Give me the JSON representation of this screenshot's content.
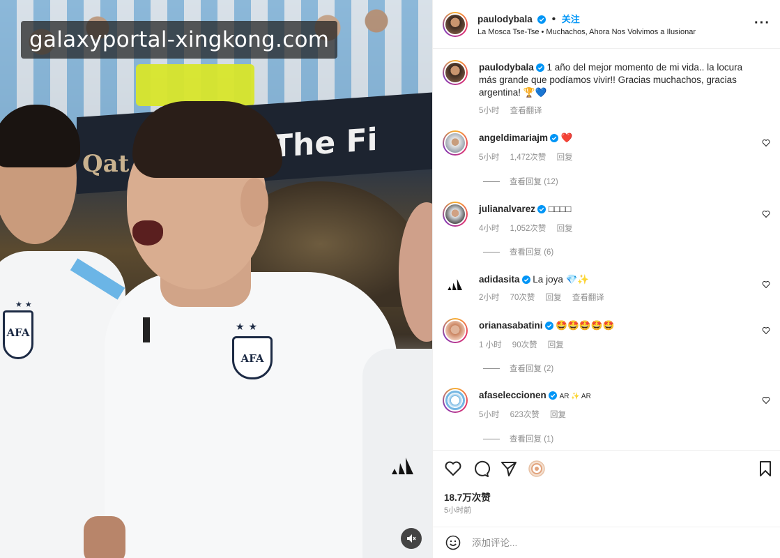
{
  "watermark": "galaxyportal-xingkong.com",
  "media": {
    "banner_text": "The Fi",
    "banner_qat": "Qat",
    "crest_text": "AFA",
    "stars": "★★"
  },
  "post": {
    "username": "paulodybala",
    "follow_label": "关注",
    "subtitle": "La Mosca Tse-Tse • Muchachos, Ahora Nos Volvimos a Ilusionar",
    "caption": "1 año del mejor momento de mi vida.. la locura más grande que podíamos vivir!! Gracias muchachos, gracias argentina! 🏆💙",
    "caption_time": "5小时",
    "translate_label": "查看翻译",
    "likes": "18.7万次赞",
    "time_ago": "5小时前",
    "comment_placeholder": "添加评论..."
  },
  "comments": [
    {
      "username": "angeldimariajm",
      "text": "❤️",
      "time": "5小时",
      "likes": "1,472次赞",
      "reply": "回复",
      "view_replies": "查看回复 (12)"
    },
    {
      "username": "julianalvarez",
      "text": "□□□□",
      "time": "4小时",
      "likes": "1,052次赞",
      "reply": "回复",
      "view_replies": "查看回复 (6)"
    },
    {
      "username": "adidasita",
      "text": "La joya 💎✨",
      "time": "2小时",
      "likes": "70次赞",
      "reply": "回复",
      "translate": "查看翻译"
    },
    {
      "username": "orianasabatini",
      "text": "🤩🤩🤩🤩🤩",
      "time": "1 小时",
      "likes": "90次赞",
      "reply": "回复",
      "view_replies": "查看回复 (2)"
    },
    {
      "username": "afaseleccionen",
      "text": "AR ✨ AR",
      "time": "5小时",
      "likes": "623次赞",
      "reply": "回复",
      "view_replies": "查看回复 (1)"
    }
  ],
  "icons": {
    "verified": "verified-badge-icon",
    "heart": "heart-icon",
    "comment": "comment-icon",
    "share": "send-icon",
    "bookmark": "bookmark-icon",
    "emoji": "emoji-icon",
    "mute": "mute-icon",
    "more": "more-options-icon"
  },
  "colors": {
    "accent": "#0095f6",
    "text": "#262626",
    "muted": "#8e8e8e",
    "like_red": "#ed4956"
  }
}
